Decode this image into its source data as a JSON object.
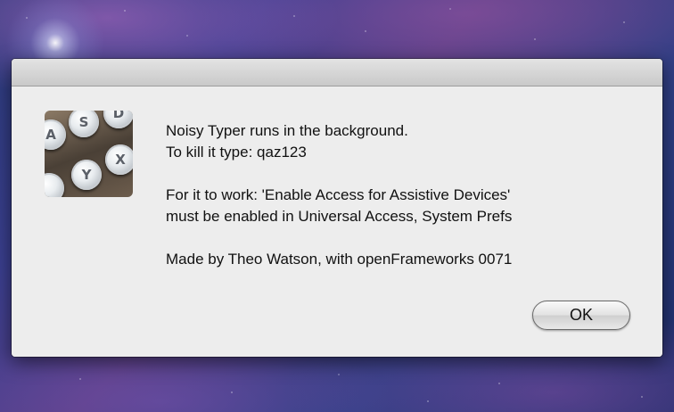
{
  "dialog": {
    "lines": [
      "Noisy Typer runs in the background.",
      "To kill it type: qaz123",
      "For it to work: 'Enable Access for Assistive Devices'",
      "must be enabled in Universal Access, System Prefs",
      "Made by Theo Watson, with openFrameworks 0071"
    ],
    "ok_label": "OK"
  },
  "icon": {
    "name": "typewriter-keys-icon",
    "keys": [
      "A",
      "S",
      "D",
      "Y",
      "X"
    ]
  },
  "colors": {
    "dialog_bg": "#ececec",
    "text": "#111111"
  }
}
